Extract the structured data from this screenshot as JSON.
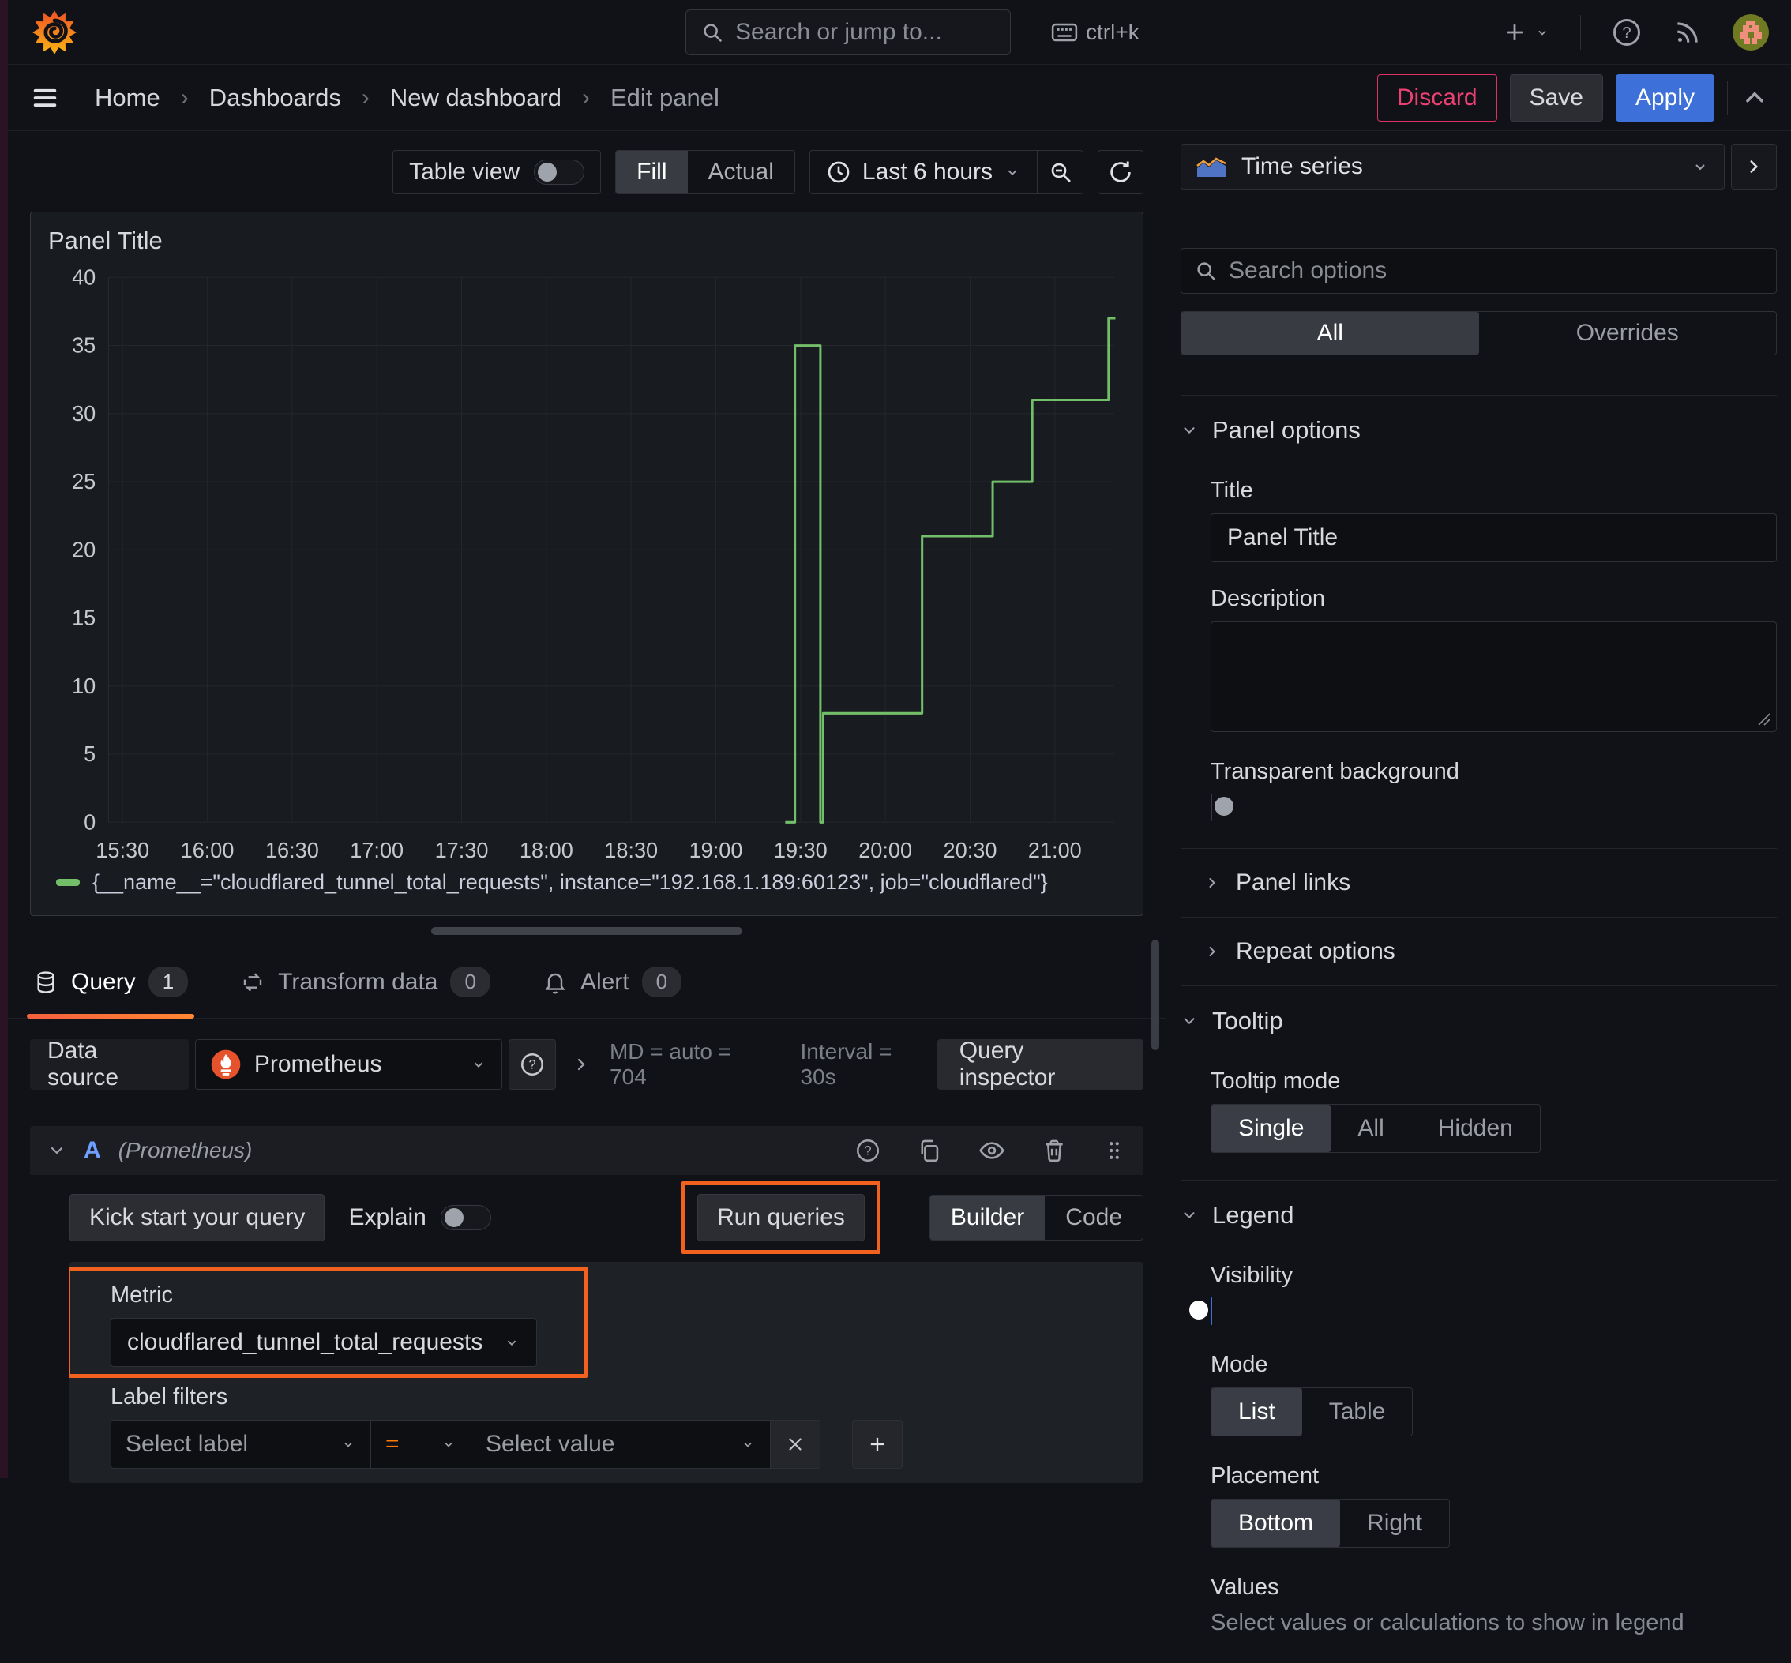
{
  "topnav": {
    "search_placeholder": "Search or jump to...",
    "shortcut": "ctrl+k"
  },
  "breadcrumb": {
    "items": [
      "Home",
      "Dashboards",
      "New dashboard",
      "Edit panel"
    ],
    "discard": "Discard",
    "save": "Save",
    "apply": "Apply"
  },
  "toolbar": {
    "table_view": "Table view",
    "fill": "Fill",
    "actual": "Actual",
    "time_range": "Last 6 hours"
  },
  "panel": {
    "title": "Panel Title",
    "legend": "{__name__=\"cloudflared_tunnel_total_requests\", instance=\"192.168.1.189:60123\", job=\"cloudflared\"}"
  },
  "chart_data": {
    "type": "line",
    "render": "step",
    "title": "Panel Title",
    "xlabel": "",
    "ylabel": "",
    "x_ticks": [
      "15:30",
      "16:00",
      "16:30",
      "17:00",
      "17:30",
      "18:00",
      "18:30",
      "19:00",
      "19:30",
      "20:00",
      "20:30",
      "21:00"
    ],
    "x_range": [
      "15:25",
      "21:21"
    ],
    "y_ticks": [
      0,
      5,
      10,
      15,
      20,
      25,
      30,
      35,
      40
    ],
    "ylim": [
      0,
      40
    ],
    "grid": true,
    "legend_position": "bottom",
    "series": [
      {
        "name": "{__name__=\"cloudflared_tunnel_total_requests\", instance=\"192.168.1.189:60123\", job=\"cloudflared\"}",
        "color": "#73bf69",
        "points": [
          [
            "19:25",
            0
          ],
          [
            "19:28",
            0
          ],
          [
            "19:28",
            35
          ],
          [
            "19:37",
            35
          ],
          [
            "19:37",
            0
          ],
          [
            "19:38",
            0
          ],
          [
            "19:38",
            8
          ],
          [
            "20:13",
            8
          ],
          [
            "20:13",
            21
          ],
          [
            "20:38",
            21
          ],
          [
            "20:38",
            25
          ],
          [
            "20:52",
            25
          ],
          [
            "20:52",
            31
          ],
          [
            "21:19",
            31
          ],
          [
            "21:19",
            37
          ],
          [
            "21:21",
            37
          ]
        ]
      }
    ]
  },
  "tabs": {
    "query": "Query",
    "query_count": "1",
    "transform": "Transform data",
    "transform_count": "0",
    "alert": "Alert",
    "alert_count": "0"
  },
  "datasource": {
    "label": "Data source",
    "name": "Prometheus",
    "stats_md": "MD = auto = 704",
    "stats_interval": "Interval = 30s",
    "inspector": "Query inspector"
  },
  "query": {
    "ref_id": "A",
    "ds_hint": "(Prometheus)",
    "kick_start": "Kick start your query",
    "explain": "Explain",
    "run": "Run queries",
    "builder": "Builder",
    "code": "Code",
    "metric_label": "Metric",
    "metric_value": "cloudflared_tunnel_total_requests",
    "label_filters": "Label filters",
    "select_label": "Select label",
    "operator": "=",
    "select_value": "Select value"
  },
  "sidebar": {
    "viz": "Time series",
    "search_placeholder": "Search options",
    "tab_all": "All",
    "tab_overrides": "Overrides",
    "panel_options": {
      "title": "Panel options",
      "title_label": "Title",
      "title_value": "Panel Title",
      "description_label": "Description",
      "transparent": "Transparent background"
    },
    "panel_links": "Panel links",
    "repeat_options": "Repeat options",
    "tooltip": {
      "title": "Tooltip",
      "mode_label": "Tooltip mode",
      "options": [
        "Single",
        "All",
        "Hidden"
      ],
      "selected": "Single"
    },
    "legend": {
      "title": "Legend",
      "visibility": "Visibility",
      "mode_label": "Mode",
      "mode_options": [
        "List",
        "Table"
      ],
      "mode_selected": "List",
      "placement_label": "Placement",
      "placement_options": [
        "Bottom",
        "Right"
      ],
      "placement_selected": "Bottom",
      "values_label": "Values",
      "values_hint": "Select values or calculations to show in legend"
    }
  },
  "colors": {
    "series_green": "#73bf69",
    "primary_blue": "#3d71d9",
    "annotation_orange": "#f2611d",
    "discard_pink": "#ee4173",
    "tab_underline_from": "#f55f3e",
    "tab_underline_to": "#ff8833"
  }
}
